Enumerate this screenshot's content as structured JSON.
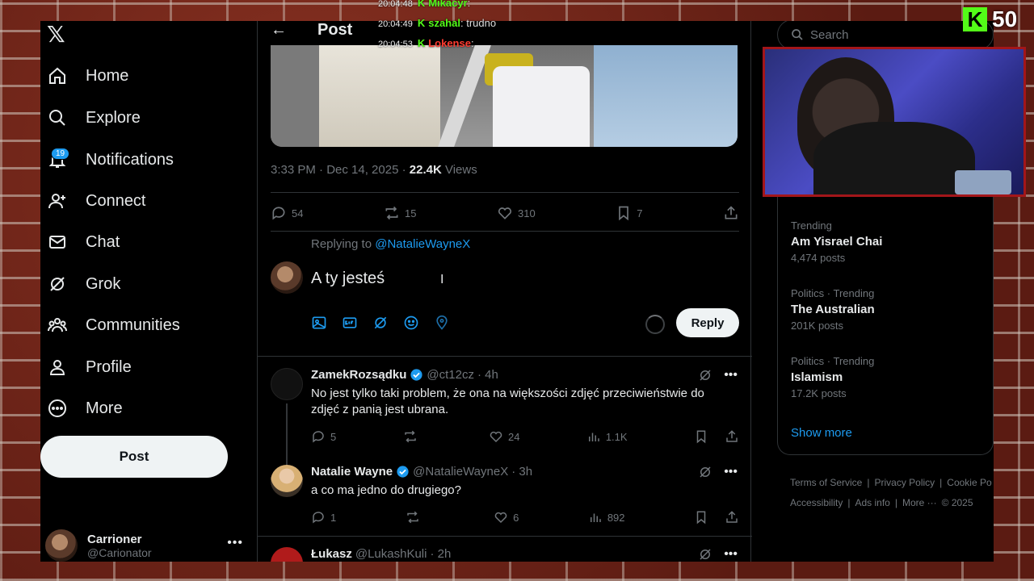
{
  "brand": {
    "logo": "𝕏",
    "accent": "#1d9bf0",
    "kick_green": "#53fc18"
  },
  "nav": {
    "items": [
      {
        "label": "Home",
        "icon": "home-icon"
      },
      {
        "label": "Explore",
        "icon": "search-icon"
      },
      {
        "label": "Notifications",
        "icon": "bell-icon",
        "badge": "19"
      },
      {
        "label": "Connect",
        "icon": "person-plus-icon"
      },
      {
        "label": "Chat",
        "icon": "mail-icon"
      },
      {
        "label": "Grok",
        "icon": "grok-icon"
      },
      {
        "label": "Communities",
        "icon": "communities-icon"
      },
      {
        "label": "Profile",
        "icon": "person-icon"
      },
      {
        "label": "More",
        "icon": "more-circle-icon"
      }
    ],
    "post_button": "Post",
    "account": {
      "name": "Carrioner",
      "handle": "@Carionator"
    }
  },
  "header": {
    "title": "Post"
  },
  "post": {
    "meta_time": "3:33 PM · Dec 14, 2025 · ",
    "meta_views_count": "22.4K",
    "meta_views_label": " Views",
    "stats": {
      "replies": "54",
      "reposts": "15",
      "likes": "310",
      "bookmarks": "7"
    }
  },
  "composer": {
    "replying_prefix": "Replying to ",
    "replying_handle": "@NatalieWayneX",
    "text": "A ty jesteś",
    "reply_button": "Reply"
  },
  "comments": [
    {
      "name": "ZamekRozsądku",
      "handle": "@ct12cz",
      "time": "· 4h",
      "text": "No jest tylko taki problem, że ona na większości zdjęć przeciwieństwie do zdjęć z panią jest ubrana.",
      "replies": "5",
      "reposts": "",
      "likes": "24",
      "views": "1.1K"
    },
    {
      "name": "Natalie Wayne",
      "handle": "@NatalieWayneX",
      "time": "· 3h",
      "text": "a co ma jedno do drugiego?",
      "replies": "1",
      "reposts": "",
      "likes": "6",
      "views": "892"
    },
    {
      "name": "Łukasz",
      "handle": "@LukashKuli",
      "time": "· 2h"
    }
  ],
  "right": {
    "search_placeholder": "Search",
    "trends": [
      {
        "category": "Trending",
        "name": "Am Yisrael Chai",
        "count": "4,474 posts"
      },
      {
        "category": "Politics · Trending",
        "name": "The Australian",
        "count": "201K posts"
      },
      {
        "category": "Politics · Trending",
        "name": "Islamism",
        "count": "17.2K posts"
      }
    ],
    "show_more": "Show more",
    "footer": [
      "Terms of Service",
      "|",
      "Privacy Policy",
      "|",
      "Cookie Po",
      "Accessibility",
      "|",
      "Ads info",
      "|",
      "More ···",
      "© 2025"
    ]
  },
  "stream": {
    "chat": [
      {
        "time": "20:04:48",
        "user": "Mikacyr",
        "user_color": "#53fc18",
        "message": ""
      },
      {
        "time": "20:04:49",
        "user": "szahal",
        "user_color": "#53fc18",
        "message": "trudno"
      },
      {
        "time": "20:04:53",
        "user": "Lokense",
        "user_color": "#ff3b30",
        "message": ""
      }
    ],
    "counter": "50",
    "counter_icon": "K"
  }
}
